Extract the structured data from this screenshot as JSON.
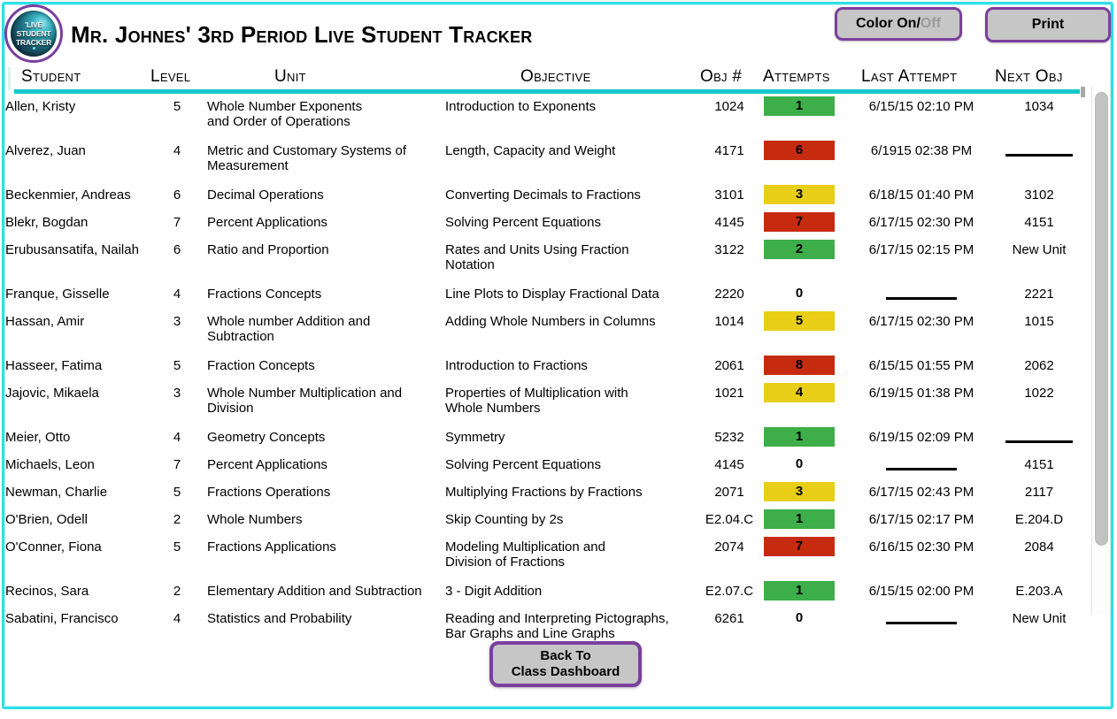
{
  "app": {
    "title": "Mr. Johnes' 3rd Period Live Student Tracker",
    "logo_line1": "'LIVE",
    "logo_line2": "STUDENT",
    "logo_line3": "TRACKER"
  },
  "toolbar": {
    "color_toggle_on": "Color On/",
    "color_toggle_off": "Off",
    "print_label": "Print"
  },
  "footer": {
    "back_line1": "Back To",
    "back_line2": "Class Dashboard"
  },
  "colors": {
    "accent_teal": "#16c8cd",
    "frame_cyan": "#2fe0e6",
    "button_purple": "#7b3f9d",
    "button_gray": "#c6c6c6",
    "green": "#3dae4a",
    "yellow": "#e8ce17",
    "red": "#c62b10"
  },
  "table": {
    "headers": [
      "Student",
      "Level",
      "Unit",
      "Objective",
      "Obj #",
      "Attempts",
      "Last Attempt",
      "Next Obj"
    ],
    "rows": [
      {
        "student": "Allen, Kristy",
        "level": "5",
        "unit": "Whole Number Exponents\nand Order of Operations",
        "objective": "Introduction to Exponents",
        "obj_num": "1024",
        "attempts": "1",
        "attempts_color": "green",
        "last_attempt": "6/15/15  02:10 PM",
        "next_obj": "1034"
      },
      {
        "student": "Alverez, Juan",
        "level": "4",
        "unit": "Metric and Customary Systems of\nMeasurement",
        "objective": "Length, Capacity and Weight",
        "obj_num": "4171",
        "attempts": "6",
        "attempts_color": "red",
        "last_attempt": "6/1915  02:38 PM",
        "next_obj": "—"
      },
      {
        "student": "Beckenmier, Andreas",
        "level": "6",
        "unit": "Decimal Operations",
        "objective": "Converting Decimals to Fractions",
        "obj_num": "3101",
        "attempts": "3",
        "attempts_color": "yellow",
        "last_attempt": "6/18/15  01:40 PM",
        "next_obj": "3102"
      },
      {
        "student": "Blekr, Bogdan",
        "level": "7",
        "unit": "Percent Applications",
        "objective": "Solving Percent Equations",
        "obj_num": "4145",
        "attempts": "7",
        "attempts_color": "red",
        "last_attempt": "6/17/15  02:30 PM",
        "next_obj": "4151"
      },
      {
        "student": "Erubusansatifa, Nailah",
        "level": "6",
        "unit": "Ratio and Proportion",
        "objective": "Rates and Units Using Fraction\nNotation",
        "obj_num": "3122",
        "attempts": "2",
        "attempts_color": "green",
        "last_attempt": "6/17/15  02:15 PM",
        "next_obj": "New Unit"
      },
      {
        "student": "Franque, Gisselle",
        "level": "4",
        "unit": "Fractions Concepts",
        "objective": "Line Plots to Display Fractional Data",
        "obj_num": "2220",
        "attempts": "0",
        "attempts_color": "none",
        "last_attempt": "—",
        "next_obj": "2221"
      },
      {
        "student": "Hassan, Amir",
        "level": "3",
        "unit": "Whole number Addition and\nSubtraction",
        "objective": "Adding Whole Numbers in Columns",
        "obj_num": "1014",
        "attempts": "5",
        "attempts_color": "yellow",
        "last_attempt": "6/17/15  02:30 PM",
        "next_obj": "1015"
      },
      {
        "student": "Hasseer, Fatima",
        "level": "5",
        "unit": "Fraction Concepts",
        "objective": "Introduction to Fractions",
        "obj_num": "2061",
        "attempts": "8",
        "attempts_color": "red",
        "last_attempt": "6/15/15  01:55 PM",
        "next_obj": "2062"
      },
      {
        "student": "Jajovic, Mikaela",
        "level": "3",
        "unit": "Whole Number Multiplication and\nDivision",
        "objective": "Properties of Multiplication with\nWhole Numbers",
        "obj_num": "1021",
        "attempts": "4",
        "attempts_color": "yellow",
        "last_attempt": "6/19/15  01:38 PM",
        "next_obj": "1022"
      },
      {
        "student": "Meier, Otto",
        "level": "4",
        "unit": "Geometry Concepts",
        "objective": "Symmetry",
        "obj_num": "5232",
        "attempts": "1",
        "attempts_color": "green",
        "last_attempt": "6/19/15  02:09 PM",
        "next_obj": "—"
      },
      {
        "student": "Michaels, Leon",
        "level": "7",
        "unit": "Percent Applications",
        "objective": "Solving Percent Equations",
        "obj_num": "4145",
        "attempts": "0",
        "attempts_color": "none",
        "last_attempt": "—",
        "next_obj": "4151"
      },
      {
        "student": "Newman, Charlie",
        "level": "5",
        "unit": "Fractions Operations",
        "objective": "Multiplying Fractions by Fractions",
        "obj_num": "2071",
        "attempts": "3",
        "attempts_color": "yellow",
        "last_attempt": "6/17/15  02:43 PM",
        "next_obj": "2117"
      },
      {
        "student": "O'Brien, Odell",
        "level": "2",
        "unit": "Whole Numbers",
        "objective": "Skip Counting by 2s",
        "obj_num": "E2.04.C",
        "attempts": "1",
        "attempts_color": "green",
        "last_attempt": "6/17/15  02:17 PM",
        "next_obj": "E.204.D"
      },
      {
        "student": "O'Conner, Fiona",
        "level": "5",
        "unit": "Fractions Applications",
        "objective": "Modeling Multiplication and\n Division of Fractions",
        "obj_num": "2074",
        "attempts": "7",
        "attempts_color": "red",
        "last_attempt": "6/16/15  02:30 PM",
        "next_obj": "2084"
      },
      {
        "student": "Recinos, Sara",
        "level": "2",
        "unit": "Elementary Addition and Subtraction",
        "objective": "3 - Digit Addition",
        "obj_num": "E2.07.C",
        "attempts": "1",
        "attempts_color": "green",
        "last_attempt": "6/15/15  02:00 PM",
        "next_obj": "E.203.A"
      },
      {
        "student": "Sabatini, Francisco",
        "level": "4",
        "unit": "Statistics and Probability",
        "objective": "Reading and Interpreting Pictographs,\nBar Graphs and Line Graphs",
        "obj_num": "6261",
        "attempts": "0",
        "attempts_color": "none",
        "last_attempt": "—",
        "next_obj": "New Unit"
      }
    ]
  }
}
